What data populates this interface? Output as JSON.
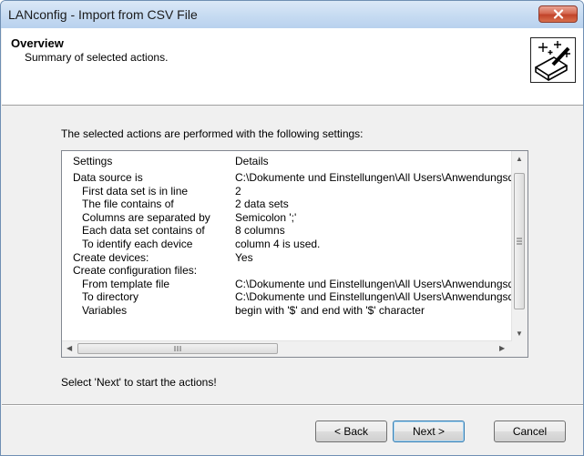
{
  "window": {
    "title": "LANconfig - Import from CSV File"
  },
  "header": {
    "title": "Overview",
    "subtitle": "Summary of selected actions.",
    "icon": "wizard-magic-icon"
  },
  "intro": "The selected actions are performed with the following settings:",
  "table": {
    "columns": [
      "Settings",
      "Details"
    ],
    "rows": [
      {
        "setting": "Data source is",
        "indent": false,
        "detail": "C:\\Dokumente und Einstellungen\\All Users\\Anwendungsdaten"
      },
      {
        "setting": "First data set is in line",
        "indent": true,
        "detail": "2"
      },
      {
        "setting": "The file contains of",
        "indent": true,
        "detail": "2 data sets"
      },
      {
        "setting": "Columns are separated by",
        "indent": true,
        "detail": "Semicolon ';'"
      },
      {
        "setting": "Each data set contains of",
        "indent": true,
        "detail": "8 columns"
      },
      {
        "setting": "To identify each device",
        "indent": true,
        "detail": "column 4 is used."
      },
      {
        "setting": "Create devices:",
        "indent": false,
        "detail": "Yes"
      },
      {
        "setting": "Create configuration files:",
        "indent": false,
        "detail": ""
      },
      {
        "setting": "From template file",
        "indent": true,
        "detail": "C:\\Dokumente und Einstellungen\\All Users\\Anwendungsdaten"
      },
      {
        "setting": "To directory",
        "indent": true,
        "detail": "C:\\Dokumente und Einstellungen\\All Users\\Anwendungsdaten"
      },
      {
        "setting": "Variables",
        "indent": true,
        "detail": "begin with '$' and end with '$' character"
      }
    ]
  },
  "footer_text": "Select 'Next' to start the actions!",
  "buttons": {
    "back": "< Back",
    "next": "Next >",
    "cancel": "Cancel"
  }
}
